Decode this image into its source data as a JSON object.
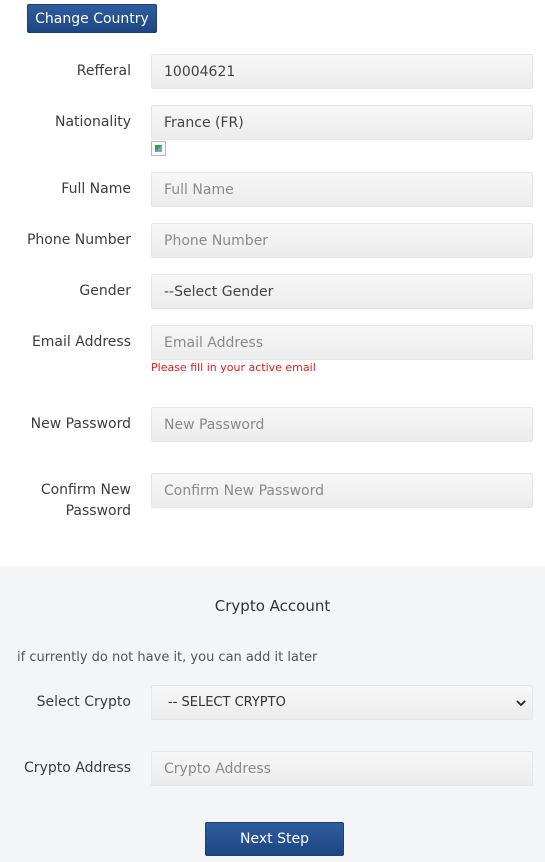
{
  "header": {
    "change_country_label": "Change Country"
  },
  "form": {
    "referral": {
      "label": "Refferal",
      "value": "10004621"
    },
    "nationality": {
      "label": "Nationality",
      "value": "France (FR)"
    },
    "full_name": {
      "label": "Full Name",
      "placeholder": "Full Name"
    },
    "phone": {
      "label": "Phone Number",
      "placeholder": "Phone Number"
    },
    "gender": {
      "label": "Gender",
      "selected": "--Select Gender"
    },
    "email": {
      "label": "Email Address",
      "placeholder": "Email Address",
      "hint": "Please fill in your active email"
    },
    "new_password": {
      "label": "New Password",
      "placeholder": "New Password"
    },
    "confirm_password": {
      "label_line1": "Confirm New",
      "label_line2": "Password",
      "placeholder": "Confirm New Password"
    }
  },
  "crypto": {
    "title": "Crypto Account",
    "note": "if currently do not have it, you can add it later",
    "select": {
      "label": "Select Crypto",
      "selected": "-- SELECT CRYPTO"
    },
    "address": {
      "label": "Crypto Address",
      "placeholder": "Crypto Address"
    }
  },
  "footer": {
    "next_label": "Next Step"
  },
  "icons": {
    "select_caret": "chevron-down-icon",
    "broken_image": "broken-image-icon"
  },
  "colors": {
    "primary_button": "#1e4583",
    "hint_text": "#e31b1b",
    "section_bg": "#f4f5f7"
  }
}
